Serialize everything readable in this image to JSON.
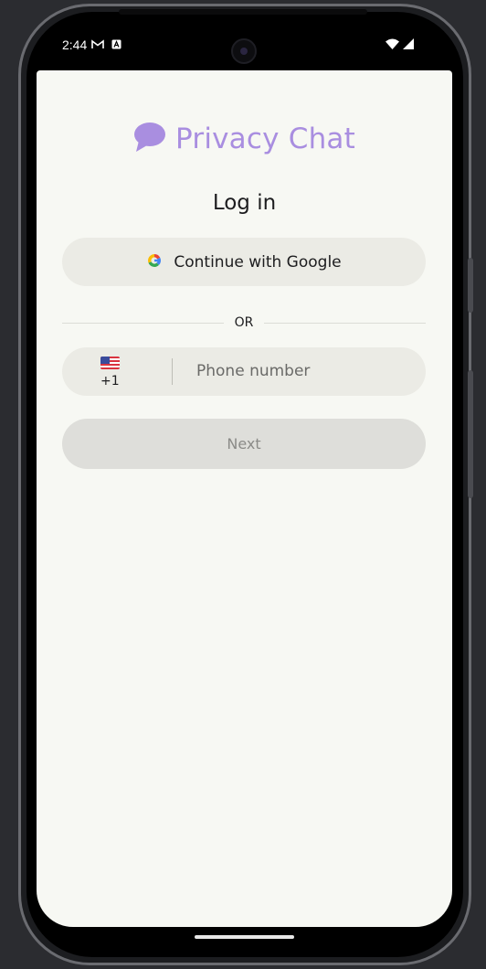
{
  "status_bar": {
    "time": "2:44",
    "icons": [
      "gmail-icon",
      "app-notification-icon",
      "wifi-icon",
      "signal-icon"
    ]
  },
  "app": {
    "brand_name": "Privacy Chat",
    "brand_color": "#a98ee0",
    "brand_icon": "chat-bubble-icon"
  },
  "login": {
    "title": "Log in",
    "google_button_label": "Continue with Google",
    "divider_text": "OR",
    "country_flag": "us-flag-icon",
    "country_code": "+1",
    "phone_placeholder": "Phone number",
    "phone_value": "",
    "next_button_label": "Next"
  },
  "colors": {
    "background": "#f7f8f3",
    "button_fill": "#ebebe5",
    "disabled_button": "#dededa",
    "text": "#1d1d1f"
  }
}
